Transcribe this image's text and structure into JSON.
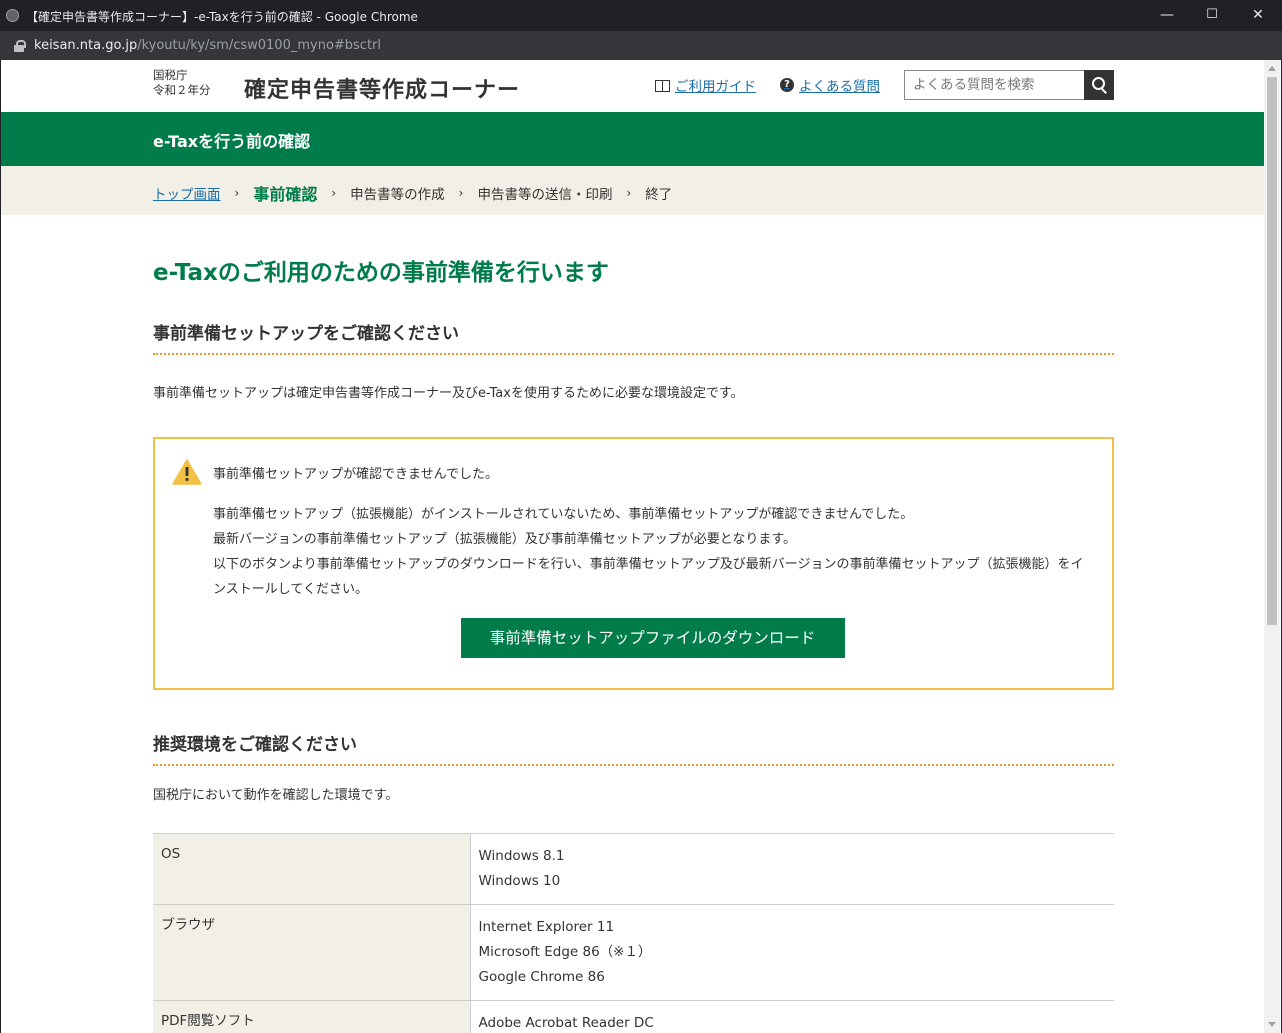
{
  "window": {
    "title": "【確定申告書等作成コーナー】-e-Taxを行う前の確認 - Google Chrome",
    "url_domain": "keisan.nta.go.jp",
    "url_path": "/kyoutu/ky/sm/csw0100_myno#bsctrl",
    "minimize": "—",
    "maximize": "☐",
    "close": "✕"
  },
  "header": {
    "agency": "国税庁",
    "year": "令和２年分",
    "site_title": "確定申告書等作成コーナー",
    "guide_link": "ご利用ガイド",
    "faq_link": "よくある質問",
    "search_placeholder": "よくある質問を検索"
  },
  "section_bar": {
    "title": "e-Taxを行う前の確認"
  },
  "breadcrumb": {
    "items": [
      "トップ画面",
      "事前確認",
      "申告書等の作成",
      "申告書等の送信・印刷",
      "終了"
    ],
    "separator": "›"
  },
  "main": {
    "heading": "e-Taxのご利用のための事前準備を行います",
    "setup_heading": "事前準備セットアップをご確認ください",
    "setup_desc": "事前準備セットアップは確定申告書等作成コーナー及びe-Taxを使用するために必要な環境設定です。",
    "alert": {
      "lead": "事前準備セットアップが確認できませんでした。",
      "line1": "事前準備セットアップ（拡張機能）がインストールされていないため、事前準備セットアップが確認できませんでした。",
      "line2": "最新バージョンの事前準備セットアップ（拡張機能）及び事前準備セットアップが必要となります。",
      "line3": "以下のボタンより事前準備セットアップのダウンロードを行い、事前準備セットアップ及び最新バージョンの事前準備セットアップ（拡張機能）をインストールしてください。",
      "button": "事前準備セットアップファイルのダウンロード"
    },
    "env_heading": "推奨環境をご確認ください",
    "env_desc": "国税庁において動作を確認した環境です。",
    "env_table": [
      {
        "label": "OS",
        "values": [
          "Windows 8.1",
          "Windows 10"
        ]
      },
      {
        "label": "ブラウザ",
        "values": [
          "Internet Explorer 11",
          "Microsoft Edge 86（※１）",
          "Google Chrome 86"
        ]
      },
      {
        "label": "PDF閲覧ソフト",
        "values": [
          "Adobe Acrobat Reader DC"
        ]
      }
    ]
  },
  "colors": {
    "brand_green": "#007b4a",
    "alert_border": "#f2c042",
    "link": "#1a6fa8",
    "breadcrumb_bg": "#f2efe6"
  }
}
